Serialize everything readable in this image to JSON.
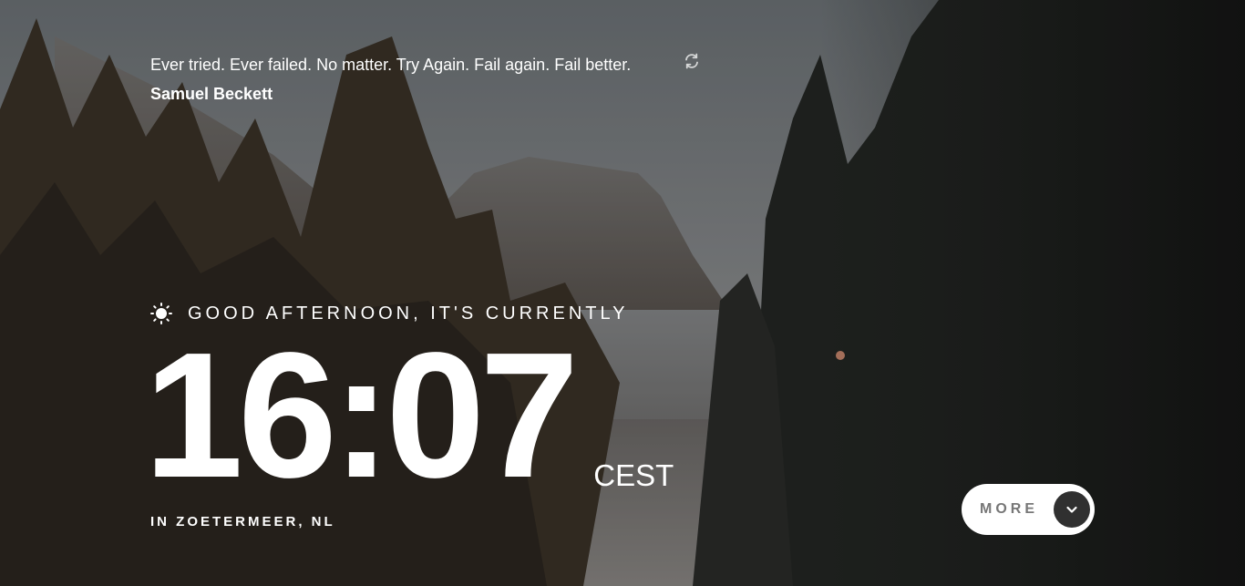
{
  "quote": {
    "text": "Ever tried. Ever failed. No matter. Try Again. Fail again. Fail better.",
    "author": "Samuel Beckett",
    "refresh_icon": "refresh-icon"
  },
  "greeting": {
    "icon": "sun-icon",
    "text": "GOOD AFTERNOON, IT'S CURRENTLY"
  },
  "clock": {
    "time": "16:07",
    "timezone": "CEST"
  },
  "location": {
    "text": "IN ZOETERMEER, NL"
  },
  "more_button": {
    "label": "MORE",
    "icon": "chevron-down-icon"
  },
  "colors": {
    "text": "#ffffff",
    "button_bg": "#ffffff",
    "button_label": "#777777",
    "chevron_bg": "#303030"
  }
}
